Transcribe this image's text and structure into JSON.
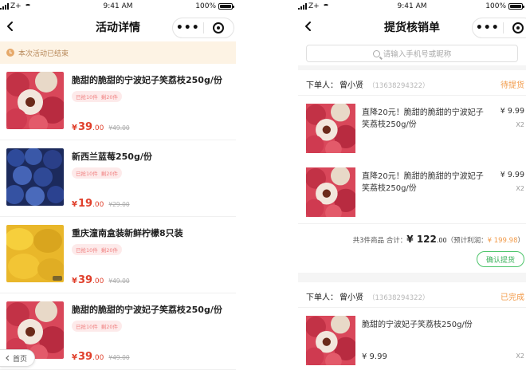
{
  "status": {
    "carrier": "Z+",
    "time": "9:41 AM",
    "battery": "100%"
  },
  "left": {
    "title": "活动详情",
    "notice": "本次活动已结束",
    "home_label": "首页",
    "products": [
      {
        "name": "脆甜的脆甜的宁波妃子笑荔枝250g/份",
        "tag_limit": "已抢10件",
        "tag_left": "剩20件",
        "price_symbol": "¥",
        "price_int": "39",
        "price_dec": ".00",
        "orig": "¥49.00",
        "image": "lychee"
      },
      {
        "name": "新西兰蓝莓250g/份",
        "tag_limit": "已抢10件",
        "tag_left": "剩20件",
        "price_symbol": "¥",
        "price_int": "19",
        "price_dec": ".00",
        "orig": "¥29.00",
        "image": "blueberry"
      },
      {
        "name": "重庆潼南盒装新鲜柠檬8只装",
        "tag_limit": "已抢10件",
        "tag_left": "剩20件",
        "price_symbol": "¥",
        "price_int": "39",
        "price_dec": ".00",
        "orig": "¥49.00",
        "image": "lemon"
      },
      {
        "name": "脆甜的脆甜的宁波妃子笑荔枝250g/份",
        "tag_limit": "已抢10件",
        "tag_left": "剩20件",
        "price_symbol": "¥",
        "price_int": "39",
        "price_dec": ".00",
        "orig": "¥49.00",
        "image": "lychee"
      }
    ]
  },
  "right": {
    "title": "提货核销单",
    "search_placeholder": "请输入手机号或昵称",
    "orders": [
      {
        "buyer_label": "下单人：",
        "buyer_name": "曾小贤",
        "phone": "（13638294322）",
        "status": "待提货",
        "items": [
          {
            "desc": "直降20元！脆甜的脆甜的宁波妃子笑荔枝250g/份",
            "price": "¥ 9.99",
            "qty": "X2"
          },
          {
            "desc": "直降20元！脆甜的脆甜的宁波妃子笑荔枝250g/份",
            "price": "¥ 9.99",
            "qty": "X2"
          }
        ],
        "summary_prefix": "共3件商品  合计：",
        "total_symbol": "¥",
        "total_int": "122",
        "total_dec": ".00",
        "profit_label": "（预计利润：",
        "profit_value": "¥ 199.98",
        "profit_end": "）",
        "button": "确认提货"
      },
      {
        "buyer_label": "下单人：",
        "buyer_name": "曾小贤",
        "phone": "（13638294322）",
        "status": "已完成",
        "items": [
          {
            "desc": "脆甜的宁波妃子笑荔枝250g/份",
            "price": "¥ 9.99",
            "qty": "X2"
          }
        ]
      }
    ]
  },
  "colors": {
    "accent_price": "#e0402c",
    "status_orange": "#f29b4a",
    "confirm_green": "#3ab15a",
    "notice_bg": "#fdf3e4"
  }
}
